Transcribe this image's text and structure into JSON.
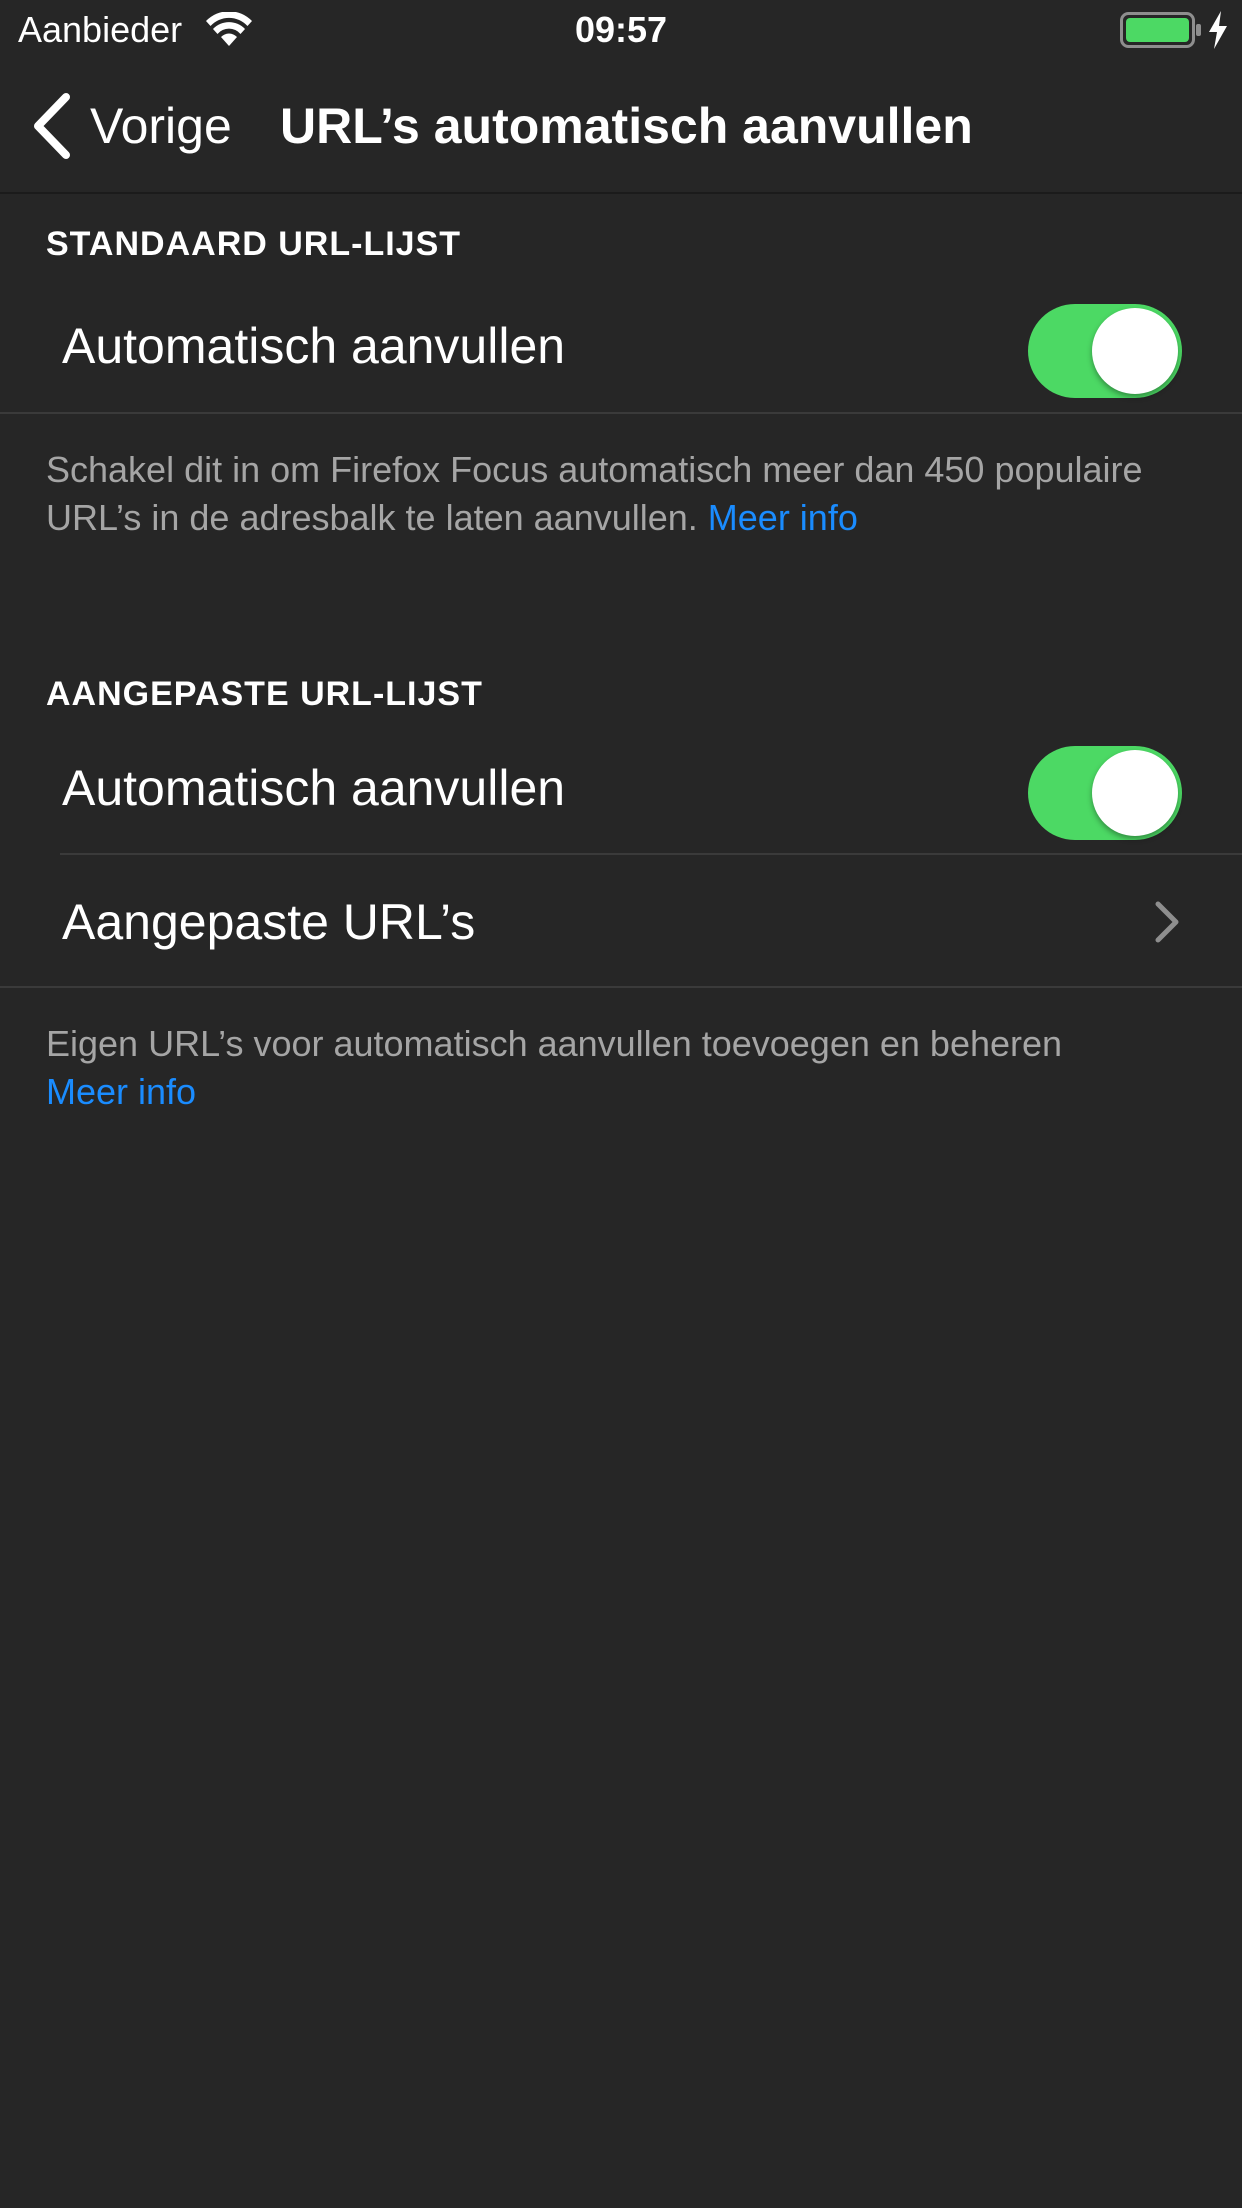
{
  "status_bar": {
    "carrier": "Aanbieder",
    "time": "09:57",
    "battery_level": 1.0
  },
  "nav": {
    "back_label": "Vorige",
    "title": "URL’s automatisch aanvullen"
  },
  "standard_section": {
    "header": "STANDAARD URL-LIJST",
    "autocomplete_label": "Automatisch aanvullen",
    "autocomplete_on": true,
    "footer_text": "Schakel dit in om Firefox Focus automatisch meer dan 450 populaire URL’s in de adresbalk te laten aanvullen.",
    "footer_link": "Meer info"
  },
  "custom_section": {
    "header": "AANGEPASTE URL-LIJST",
    "autocomplete_label": "Automatisch aanvullen",
    "autocomplete_on": true,
    "custom_urls_label": "Aangepaste URL’s",
    "footer_text": "Eigen URL’s voor automatisch aanvullen toevoegen en beheren",
    "footer_link": "Meer info"
  },
  "colors": {
    "background": "#262626",
    "toggle_on": "#4cd964",
    "link": "#1a8cff",
    "footer_text": "#a5a5a5"
  }
}
